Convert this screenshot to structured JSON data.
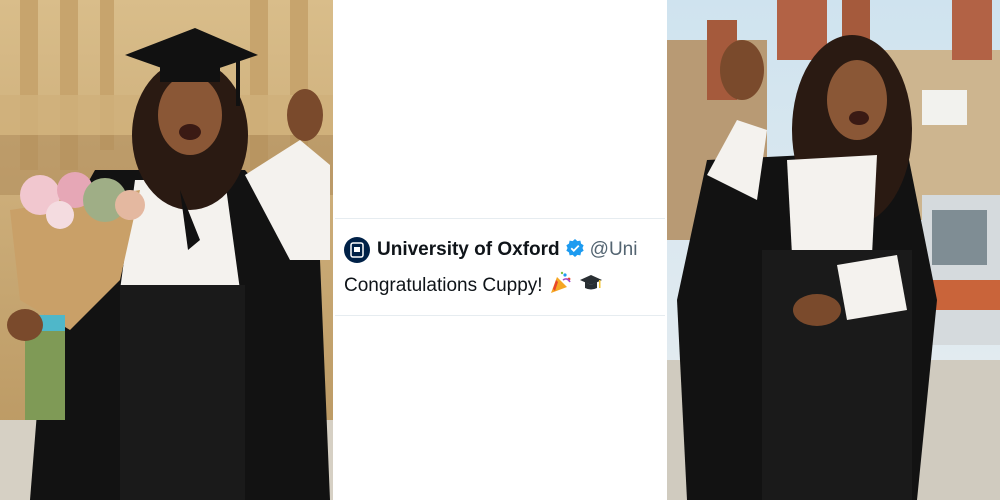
{
  "tweet": {
    "display_name": "University of Oxford",
    "handle": "@Uni",
    "text": "Congratulations Cuppy!",
    "verified": true
  },
  "icons": [
    "verified-badge-icon",
    "party-popper-icon",
    "graduation-cap-icon"
  ],
  "colors": {
    "oxford_blue": "#002147",
    "verified_blue": "#1d9bf0",
    "gown": "#111111",
    "stone": "#c9a874"
  }
}
